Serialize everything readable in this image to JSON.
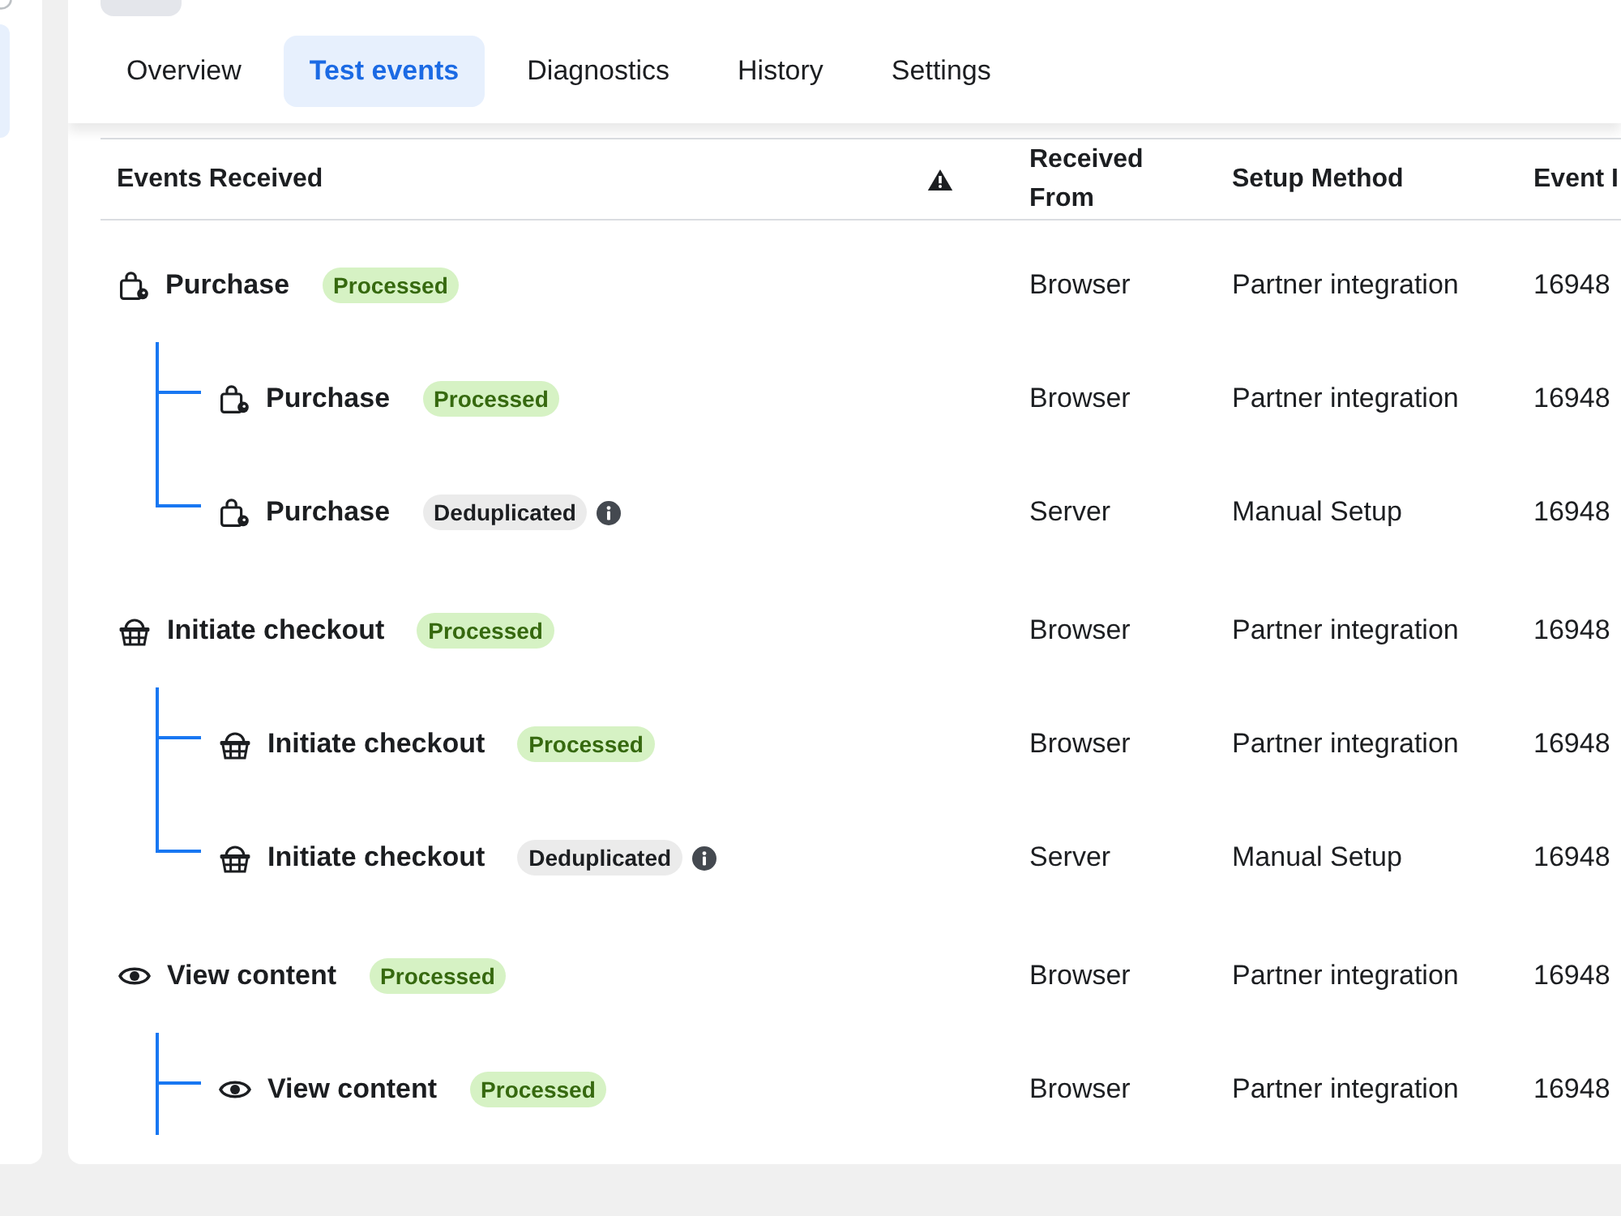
{
  "sidebar": {
    "items": [
      {
        "selected": true
      }
    ]
  },
  "tabs": [
    {
      "label": "Overview",
      "selected": false
    },
    {
      "label": "Test events",
      "selected": true
    },
    {
      "label": "Diagnostics",
      "selected": false
    },
    {
      "label": "History",
      "selected": false
    },
    {
      "label": "Settings",
      "selected": false
    }
  ],
  "table": {
    "columns": [
      "Events Received",
      "Received From",
      "Setup Method",
      "Event I"
    ],
    "groups": [
      {
        "kind": "purchase",
        "name": "Purchase",
        "badge": {
          "label": "Processed",
          "kind": "processed"
        },
        "received_from": "Browser",
        "setup_method": "Partner integration",
        "event_id": "16948",
        "continues": false,
        "children": [
          {
            "kind": "purchase",
            "name": "Purchase",
            "badge": {
              "label": "Processed",
              "kind": "processed"
            },
            "received_from": "Browser",
            "setup_method": "Partner integration",
            "event_id": "16948"
          },
          {
            "kind": "purchase",
            "name": "Purchase",
            "badge": {
              "label": "Deduplicated",
              "kind": "deduplicated"
            },
            "received_from": "Server",
            "setup_method": "Manual Setup",
            "event_id": "16948"
          }
        ]
      },
      {
        "kind": "checkout",
        "name": "Initiate checkout",
        "badge": {
          "label": "Processed",
          "kind": "processed"
        },
        "received_from": "Browser",
        "setup_method": "Partner integration",
        "event_id": "16948",
        "continues": false,
        "children": [
          {
            "kind": "checkout",
            "name": "Initiate checkout",
            "badge": {
              "label": "Processed",
              "kind": "processed"
            },
            "received_from": "Browser",
            "setup_method": "Partner integration",
            "event_id": "16948"
          },
          {
            "kind": "checkout",
            "name": "Initiate checkout",
            "badge": {
              "label": "Deduplicated",
              "kind": "deduplicated"
            },
            "received_from": "Server",
            "setup_method": "Manual Setup",
            "event_id": "16948"
          }
        ]
      },
      {
        "kind": "view",
        "name": "View content",
        "badge": {
          "label": "Processed",
          "kind": "processed"
        },
        "received_from": "Browser",
        "setup_method": "Partner integration",
        "event_id": "16948",
        "continues": true,
        "children": [
          {
            "kind": "view",
            "name": "View content",
            "badge": {
              "label": "Processed",
              "kind": "processed"
            },
            "received_from": "Browser",
            "setup_method": "Partner integration",
            "event_id": "16948"
          }
        ]
      }
    ]
  }
}
